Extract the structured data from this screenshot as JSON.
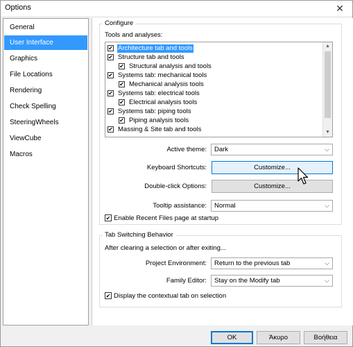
{
  "window": {
    "title": "Options"
  },
  "sidebar": {
    "items": [
      {
        "label": "General"
      },
      {
        "label": "User Interface"
      },
      {
        "label": "Graphics"
      },
      {
        "label": "File Locations"
      },
      {
        "label": "Rendering"
      },
      {
        "label": "Check Spelling"
      },
      {
        "label": "SteeringWheels"
      },
      {
        "label": "ViewCube"
      },
      {
        "label": "Macros"
      }
    ],
    "selected": "User Interface"
  },
  "configure": {
    "title": "Configure",
    "tools_label": "Tools and analyses:",
    "tools": [
      {
        "label": "Architecture tab and tools",
        "checked": true,
        "indent": 0
      },
      {
        "label": "Structure tab and tools",
        "checked": true,
        "indent": 0
      },
      {
        "label": "Structural analysis and tools",
        "checked": true,
        "indent": 1
      },
      {
        "label": "Systems tab: mechanical tools",
        "checked": true,
        "indent": 0
      },
      {
        "label": "Mechanical analysis tools",
        "checked": true,
        "indent": 1
      },
      {
        "label": "Systems tab: electrical tools",
        "checked": true,
        "indent": 0
      },
      {
        "label": "Electrical analysis tools",
        "checked": true,
        "indent": 1
      },
      {
        "label": "Systems tab: piping tools",
        "checked": true,
        "indent": 0
      },
      {
        "label": "Piping analysis tools",
        "checked": true,
        "indent": 1
      },
      {
        "label": "Massing & Site tab and tools",
        "checked": true,
        "indent": 0
      }
    ],
    "active_theme_label": "Active theme:",
    "active_theme_value": "Dark",
    "keyboard_shortcuts_label": "Keyboard Shortcuts:",
    "keyboard_shortcuts_button": "Customize...",
    "double_click_label": "Double-click Options:",
    "double_click_button": "Customize...",
    "tooltip_label": "Tooltip assistance:",
    "tooltip_value": "Normal",
    "recent_files_label": "Enable Recent Files page at startup",
    "recent_files_checked": true
  },
  "tab_switching": {
    "title": "Tab Switching Behavior",
    "subtitle": "After clearing a selection or after exiting...",
    "project_env_label": "Project Environment:",
    "project_env_value": "Return to the previous tab",
    "family_editor_label": "Family Editor:",
    "family_editor_value": "Stay on the Modify tab",
    "contextual_label": "Display the contextual tab on selection",
    "contextual_checked": true
  },
  "footer": {
    "ok": "OK",
    "cancel": "Άκυρο",
    "help": "Βοήθεια"
  },
  "icons": {
    "close": "close-icon",
    "dropdown": "chevron-down-icon",
    "check": "checkmark-icon",
    "cursor": "mouse-pointer-icon"
  },
  "colors": {
    "selection": "#3399ff",
    "focus": "#0078d7"
  }
}
